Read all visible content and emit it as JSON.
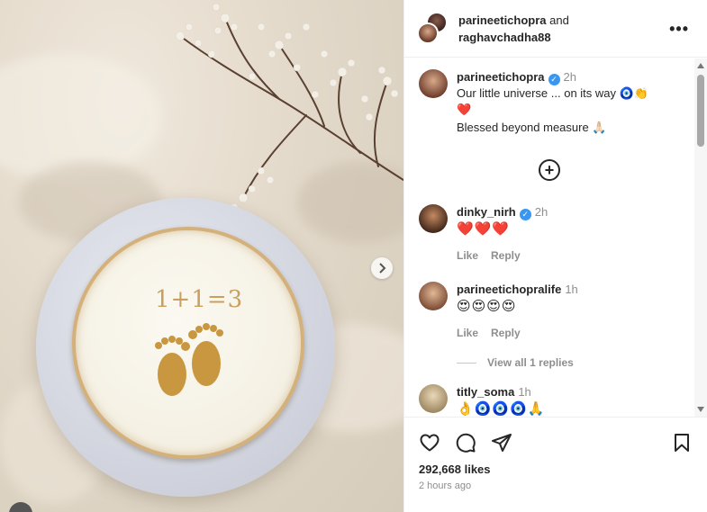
{
  "header": {
    "owner1": "parineetichopra",
    "owner_joiner": " and",
    "owner2": "raghavchadha88"
  },
  "caption": {
    "username": "parineetichopra",
    "time": "2h",
    "line1": "Our little universe ... on its way 🧿👏",
    "line2": "❤️",
    "line3": "Blessed beyond measure 🙏🏻"
  },
  "comments": [
    {
      "username": "dinky_nirh",
      "verified": true,
      "time": "2h",
      "text": "❤️❤️❤️",
      "like_label": "Like",
      "reply_label": "Reply"
    },
    {
      "username": "parineetichopralife",
      "verified": false,
      "time": "1h",
      "text": "😍😍😍😍",
      "like_label": "Like",
      "reply_label": "Reply",
      "view_replies": "View all 1 replies"
    },
    {
      "username": "titly_soma",
      "verified": false,
      "time": "1h",
      "text": "👌🧿🧿🧿🙏"
    }
  ],
  "photo": {
    "cake_text": "1+1=3"
  },
  "footer": {
    "likes": "292,668 likes",
    "posted": "2 hours ago"
  },
  "icons": {
    "more": "more-options-icon",
    "like": "heart-icon",
    "comment": "comment-icon",
    "share": "send-icon",
    "save": "bookmark-icon",
    "next": "chevron-right-icon",
    "load_more": "plus-circle-icon"
  },
  "colors": {
    "verified": "#3897f0",
    "muted": "#8e8e8e",
    "cake_gold": "#c8a060"
  }
}
